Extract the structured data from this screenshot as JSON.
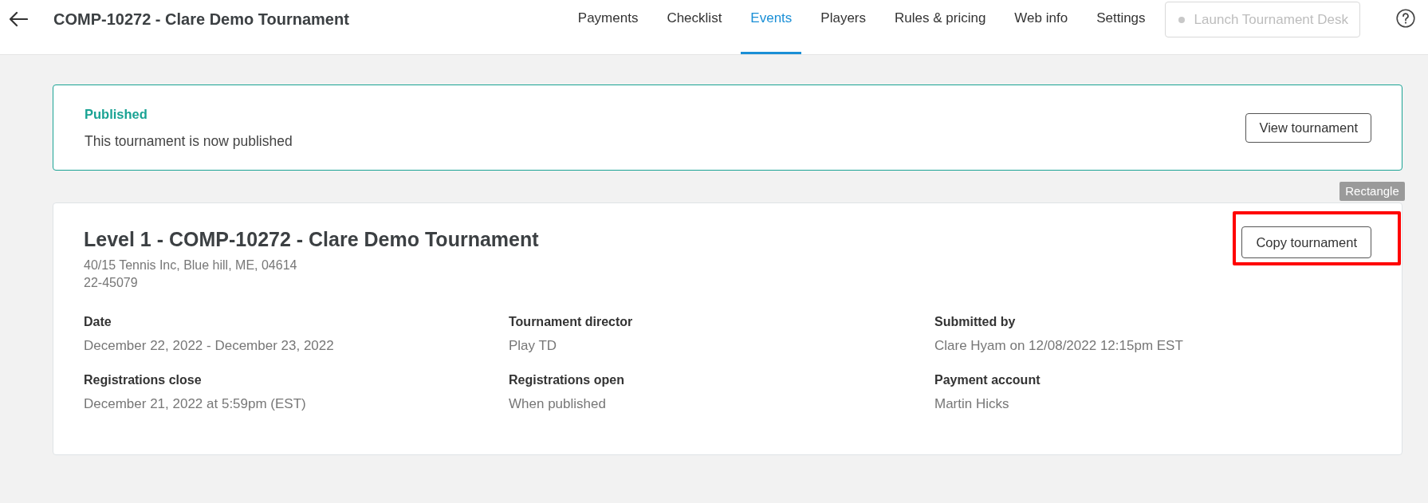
{
  "header": {
    "title": "COMP-10272 - Clare Demo Tournament",
    "nav": [
      {
        "label": "Payments",
        "selected": false
      },
      {
        "label": "Checklist",
        "selected": false
      },
      {
        "label": "Events",
        "selected": true
      },
      {
        "label": "Players",
        "selected": false
      },
      {
        "label": "Rules & pricing",
        "selected": false
      },
      {
        "label": "Web info",
        "selected": false
      },
      {
        "label": "Settings",
        "selected": false
      }
    ],
    "launch_button": {
      "label": "Launch Tournament Desk",
      "disabled": true
    }
  },
  "status_banner": {
    "title": "Published",
    "message": "This tournament is now published",
    "button": "View tournament"
  },
  "annotation_tag": "Rectangle",
  "event_card": {
    "title": "Level 1 - COMP-10272 - Clare Demo Tournament",
    "address": "40/15 Tennis Inc, Blue hill, ME, 04614",
    "code": "22-45079",
    "copy_button": {
      "label": "Copy tournament",
      "highlighted": true
    },
    "details": [
      {
        "label": "Date",
        "value": "December 22, 2022 - December 23, 2022"
      },
      {
        "label": "Tournament director",
        "value": "Play TD"
      },
      {
        "label": "Submitted by",
        "value": "Clare Hyam on 12/08/2022 12:15pm EST"
      },
      {
        "label": "Registrations close",
        "value": "December 21, 2022 at 5:59pm (EST)"
      },
      {
        "label": "Registrations open",
        "value": "When published"
      },
      {
        "label": "Payment account",
        "value": "Martin Hicks"
      }
    ]
  }
}
